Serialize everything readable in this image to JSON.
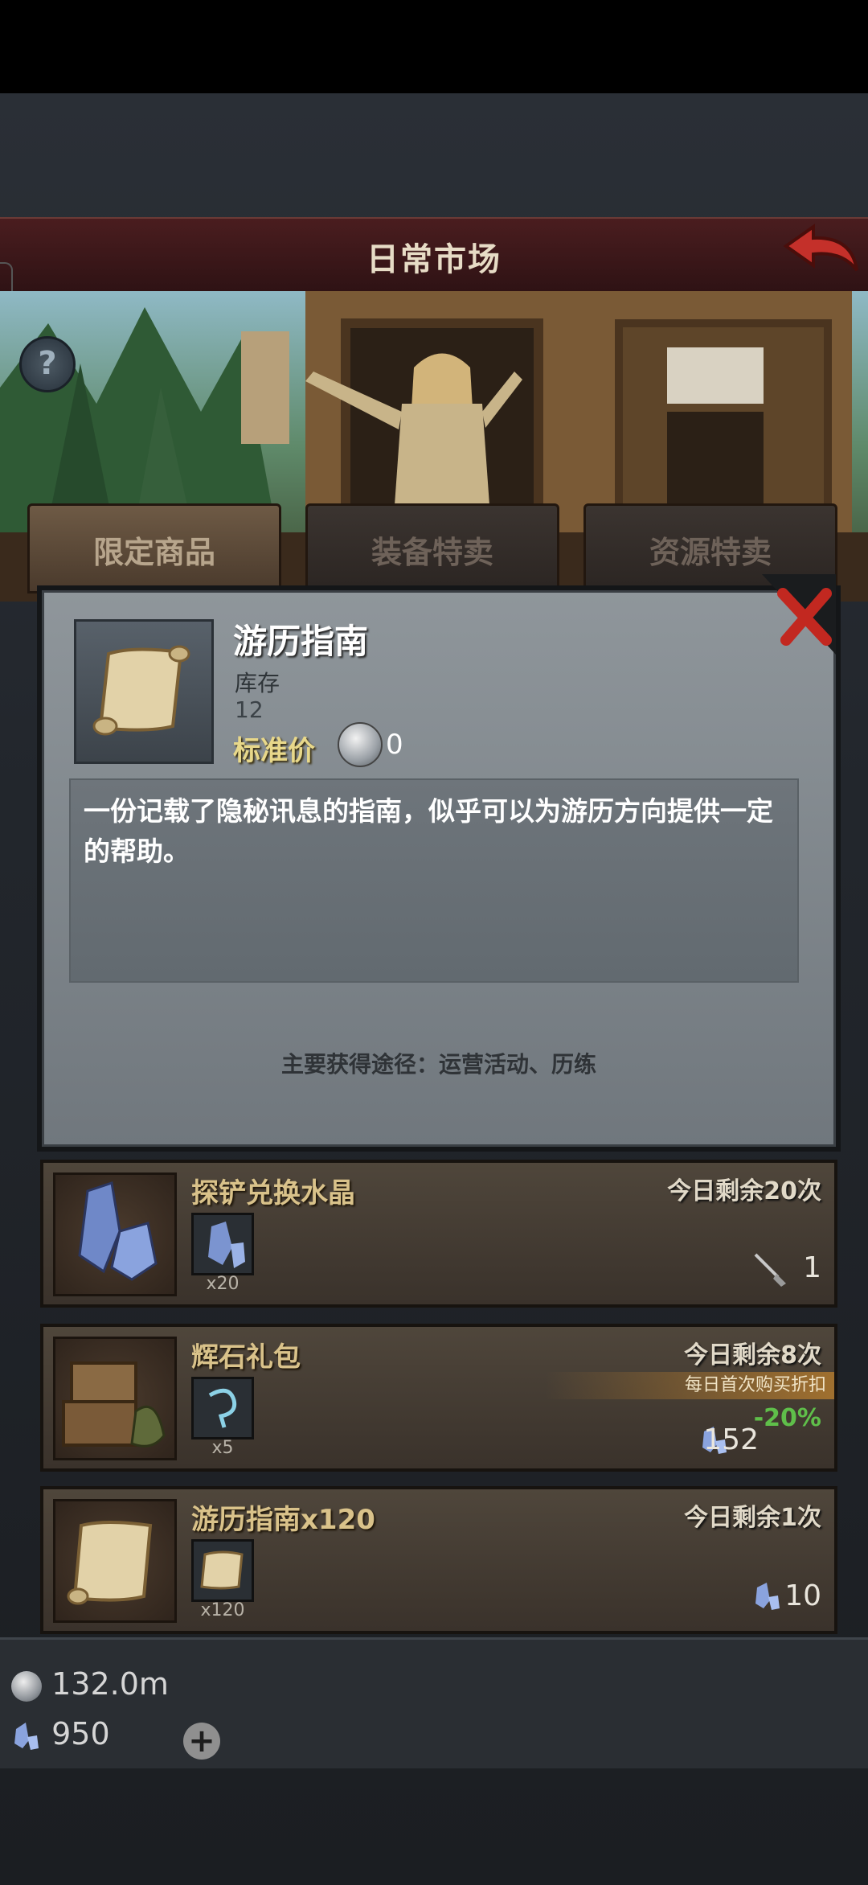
{
  "header": {
    "title": "日常市场"
  },
  "tabs": [
    {
      "label": "限定商品"
    },
    {
      "label": "装备特卖"
    },
    {
      "label": "资源特卖"
    }
  ],
  "popup": {
    "item_name": "游历指南",
    "stock_label": "库存",
    "stock_value": "12",
    "price_label": "标准价",
    "price_value": "0",
    "description": "一份记载了隐秘讯息的指南，似乎可以为游历方向提供一定的帮助。",
    "source": "主要获得途径：运营活动、历练"
  },
  "shop": [
    {
      "title": "探铲兑换水晶",
      "remaining": "今日剩余20次",
      "reward_count": "x20",
      "price": "1",
      "price_icon": "shovel-icon"
    },
    {
      "title": "辉石礼包",
      "remaining": "今日剩余8次",
      "reward_count": "x5",
      "discount_note": "每日首次购买折扣",
      "discount_pct": "-20%",
      "price": "152",
      "price_icon": "crystal-icon"
    },
    {
      "title": "游历指南x120",
      "remaining": "今日剩余1次",
      "reward_count": "x120",
      "price": "10",
      "price_icon": "crystal-icon"
    }
  ],
  "currency": {
    "silver": "132.0m",
    "crystal": "950"
  },
  "colors": {
    "accent_gold": "#d9c28a",
    "discount_green": "#5fbf4a",
    "header_red": "#4a1d1f"
  }
}
